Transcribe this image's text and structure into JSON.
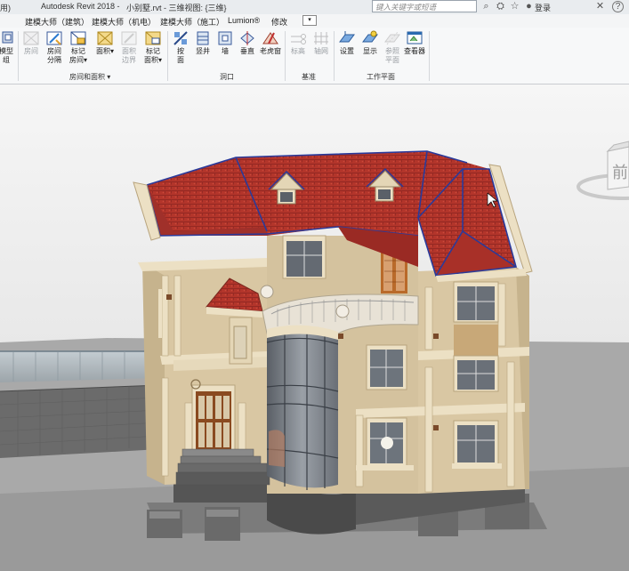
{
  "titlebar": {
    "left_text": "用)",
    "app_title": "Autodesk Revit 2018 -",
    "document_title": "小别墅.rvt - 三维视图: {三维}",
    "search_placeholder": "键入关键字或短语",
    "user_label": "登录"
  },
  "tabs": [
    "建模大师（建筑）",
    "建模大师（机电）",
    "建模大师（施工）",
    "Lumion®",
    "修改"
  ],
  "ribbon": {
    "left_label": "模型\n组",
    "room_area": {
      "buttons": [
        "房间",
        "房间\n分隔",
        "标记\n房间▾",
        "面积▾",
        "面积\n边界",
        "标记\n面积▾"
      ],
      "title": "房间和面积 ▾"
    },
    "opening": {
      "buttons": [
        "按\n面",
        "竖井",
        "墙",
        "垂直",
        "老虎窗"
      ],
      "title": "洞口"
    },
    "datum": {
      "buttons": [
        "标高",
        "轴网"
      ],
      "title": "基准"
    },
    "work_plane": {
      "buttons": [
        "设置",
        "显示",
        "参照\n平面",
        "查看器"
      ],
      "title": "工作平面"
    }
  },
  "viewcube": {
    "face_label": "前"
  },
  "colors": {
    "roof": "#b3352b",
    "roof_edge": "#2a3a9a",
    "wall": "#d9c7a3",
    "trim": "#ece0c4",
    "base": "#6a6a6a",
    "ground": "#a9a9a9"
  }
}
